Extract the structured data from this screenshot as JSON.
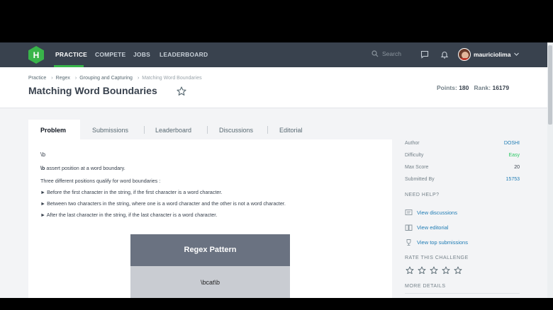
{
  "nav": {
    "logo_letter": "H",
    "links": [
      "PRACTICE",
      "COMPETE",
      "JOBS",
      "LEADERBOARD"
    ],
    "search_placeholder": "Search",
    "username": "mauriciolima"
  },
  "header": {
    "breadcrumb": [
      "Practice",
      "Regex",
      "Grouping and Capturing",
      "Matching Word Boundaries"
    ],
    "title": "Matching Word Boundaries",
    "points_label": "Points:",
    "points_value": "180",
    "rank_label": "Rank:",
    "rank_value": "16179"
  },
  "tabs": [
    "Problem",
    "Submissions",
    "Leaderboard",
    "Discussions",
    "Editorial"
  ],
  "problem": {
    "symbol": "\\b",
    "assert_bold": "\\b",
    "assert_rest": " assert position at a word boundary.",
    "intro": "Three different positions qualify for word boundaries :",
    "bullets": [
      "► Before the first character in the string, if the first character is a word character.",
      "► Between two characters in the string, where one is a word character and the other is not a word character.",
      "► After the last character in the string, if the last character is a word character."
    ],
    "regex_title": "Regex Pattern",
    "regex_value": "\\bcat\\b"
  },
  "sidebar": {
    "details": [
      {
        "key": "Author",
        "value": "DOSHI",
        "color": "#1f7cb4"
      },
      {
        "key": "Difficulty",
        "value": "Easy",
        "color": "#2ec866"
      },
      {
        "key": "Max Score",
        "value": "20",
        "color": "#39424e"
      },
      {
        "key": "Submitted By",
        "value": "15753",
        "color": "#1f7cb4"
      }
    ],
    "need_help": "NEED HELP?",
    "help_links": [
      "View discussions",
      "View editorial",
      "View top submissions"
    ],
    "rate_title": "RATE THIS CHALLENGE",
    "more_details": "MORE DETAILS"
  },
  "colors": {
    "nav_bg": "#39424e",
    "brand_green": "#39b54a",
    "link_blue": "#1f7cb4"
  }
}
